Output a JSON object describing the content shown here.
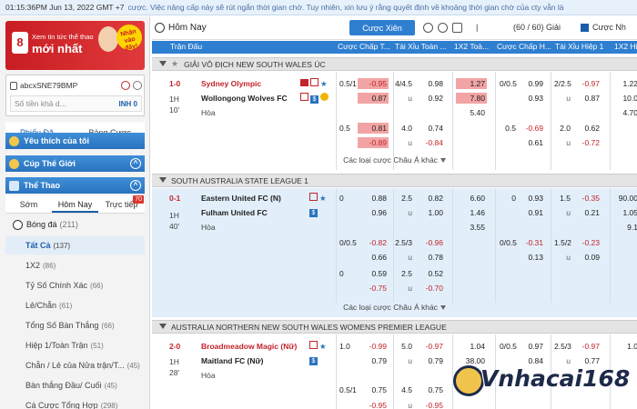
{
  "topbar": {
    "time": "01:15:36PM Jun 13, 2022 GMT +7",
    "marquee": "cược. Việc nâng cấp này sẽ rút ngắn thời gian chờ. Tuy nhiên, xin lưu ý rằng quyết định về khoảng thời gian chờ của cty vẫn là"
  },
  "banner": {
    "line1": "Xem tin tức thể thao",
    "line2": "mới nhất",
    "badge": "Nhận vào đây!",
    "logo": "8"
  },
  "account": {
    "username": "abcxSNE79BMP",
    "balance_label": "Số tiền khả d...",
    "currency": "INH 0"
  },
  "lefttabs": [
    "Phiếu Đặ...",
    "Bảng Cược"
  ],
  "favorites": "Yêu thích của tôi",
  "worldcup": "Cúp Thế Giới",
  "sports": "Thể Thao",
  "subtabs": {
    "early": "Sớm",
    "today": "Hôm Nay",
    "live": "Trực tiếp",
    "live_count": "70"
  },
  "sport": {
    "name": "Bóng đá",
    "count": "(211)"
  },
  "menu": [
    {
      "label": "Tất Cả",
      "count": "(137)"
    },
    {
      "label": "1X2",
      "count": "(86)"
    },
    {
      "label": "Tỷ Số Chính Xác",
      "count": "(66)"
    },
    {
      "label": "Lẻ/Chẵn",
      "count": "(61)"
    },
    {
      "label": "Tổng Số Bàn Thắng",
      "count": "(66)"
    },
    {
      "label": "Hiệp 1/Toàn Trận",
      "count": "(51)"
    },
    {
      "label": "Chẵn / Lẻ của Nửa trận/T...",
      "count": "(45)"
    },
    {
      "label": "Bàn thắng Đầu/ Cuối",
      "count": "(45)"
    },
    {
      "label": "Cá Cược Tổng Hợp",
      "count": "(298)"
    }
  ],
  "main": {
    "title": "Hôm Nay",
    "parlay": "Cược Xiên",
    "pages": "(60 / 60) Giải",
    "checkbox": "Cược Nh"
  },
  "columns": [
    "Trận Đấu",
    "Cược Chấp T...",
    "Tài Xỉu Toàn ...",
    "1X2 Toà...",
    "Cược Chấp H...",
    "Tài Xỉu Hiệp 1",
    "1X2 Hiệ"
  ],
  "leagues": [
    {
      "name": "GIẢI VÔ ĐỊCH NEW SOUTH WALES ÚC",
      "more": "Các loại cược Châu Á khác"
    },
    {
      "name": "SOUTH AUSTRALIA STATE LEAGUE 1",
      "more": "Các loại cược Châu Á khác"
    },
    {
      "name": "AUSTRALIA NORTHERN NEW SOUTH WALES WOMENS PREMIER LEAGUE"
    }
  ],
  "matches": [
    {
      "score": "1-0",
      "half": "1H",
      "minute": "10'",
      "home": "Sydney Olympic",
      "away": "Wollongong Wolves FC",
      "draw": "Hòa",
      "rows": [
        [
          "0.5/1",
          "-0.95",
          "4/4.5",
          "0.98",
          "1.27",
          "0/0.5",
          "0.99",
          "2/2.5",
          "-0.97",
          "1.22"
        ],
        [
          "",
          "0.87",
          "u",
          "0.92",
          "7.80",
          "",
          "0.93",
          "u",
          "0.87",
          "10.0"
        ],
        [
          "",
          "",
          "",
          "",
          "5.40",
          "",
          "",
          "",
          "",
          "4.70"
        ],
        [
          "0.5",
          "0.81",
          "4.0",
          "0.74",
          "",
          "0.5",
          "-0.69",
          "2.0",
          "0.62",
          ""
        ],
        [
          "",
          "-0.89",
          "u",
          "-0.84",
          "",
          "",
          "0.61",
          "u",
          "-0.72",
          ""
        ]
      ]
    },
    {
      "score": "0-1",
      "half": "1H",
      "minute": "40'",
      "home": "Eastern United FC (N)",
      "away": "Fulham United FC",
      "draw": "Hòa",
      "rows": [
        [
          "0",
          "0.88",
          "2.5",
          "0.82",
          "6.60",
          "0",
          "0.93",
          "1.5",
          "-0.35",
          "90.00"
        ],
        [
          "",
          "0.96",
          "u",
          "1.00",
          "1.46",
          "",
          "0.91",
          "u",
          "0.21",
          "1.05"
        ],
        [
          "",
          "",
          "",
          "",
          "3.55",
          "",
          "",
          "",
          "",
          "9.1"
        ],
        [
          "0/0.5",
          "-0.82",
          "2.5/3",
          "-0.96",
          "",
          "0/0.5",
          "-0.31",
          "1.5/2",
          "-0.23",
          ""
        ],
        [
          "",
          "0.66",
          "u",
          "0.78",
          "",
          "",
          "0.13",
          "u",
          "0.09",
          ""
        ],
        [
          "0",
          "0.59",
          "2.5",
          "0.52",
          "",
          "",
          "",
          "",
          "",
          ""
        ],
        [
          "",
          "-0.75",
          "u",
          "-0.70",
          "",
          "",
          "",
          "",
          "",
          ""
        ]
      ]
    },
    {
      "score": "2-0",
      "half": "1H",
      "minute": "28'",
      "home": "Broadmeadow Magic (Nữ)",
      "away": "Maitland FC (Nữ)",
      "draw": "Hòa",
      "rows": [
        [
          "1.0",
          "-0.99",
          "5.0",
          "-0.97",
          "1.04",
          "0/0.5",
          "0.97",
          "2.5/3",
          "-0.97",
          "1.0"
        ],
        [
          "",
          "0.79",
          "u",
          "0.79",
          "38.00",
          "",
          "0.84",
          "u",
          "0.77",
          ""
        ],
        [
          "",
          "",
          "",
          "",
          "",
          "",
          "",
          "",
          "",
          ""
        ],
        [
          "0.5/1",
          "0.75",
          "4.5",
          "0.75",
          "",
          "",
          "",
          "",
          "",
          ""
        ],
        [
          "",
          "-0.95",
          "u",
          "-0.95",
          "",
          "",
          "",
          "",
          "",
          ""
        ]
      ]
    }
  ],
  "logo_text": "Vnhacai168",
  "colors": {
    "accent": "#2f7fd0",
    "negative": "#c3242b",
    "highlight": "#f2a4a4",
    "alt_row": "#e2effa"
  }
}
